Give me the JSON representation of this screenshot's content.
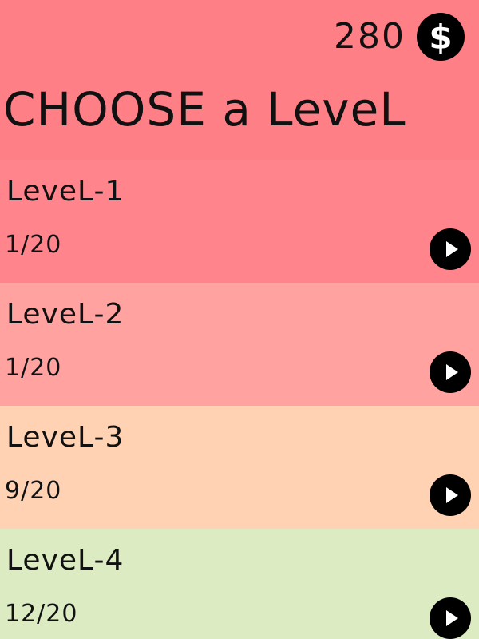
{
  "header": {
    "coins": "280",
    "coin_icon": "dollar-coin-icon",
    "coin_symbol": "$",
    "title": "CHOOSE a LeveL"
  },
  "levels": [
    {
      "name": "LeveL-1",
      "progress": "1/20",
      "color": "#ff848b"
    },
    {
      "name": "LeveL-2",
      "progress": "1/20",
      "color": "#ffa2a0"
    },
    {
      "name": "LeveL-3",
      "progress": "9/20",
      "color": "#ffd2b4"
    },
    {
      "name": "LeveL-4",
      "progress": "12/20",
      "color": "#dcebc2"
    }
  ],
  "colors": {
    "header_bg": "#ff7f87",
    "icon_bg": "#000000"
  }
}
